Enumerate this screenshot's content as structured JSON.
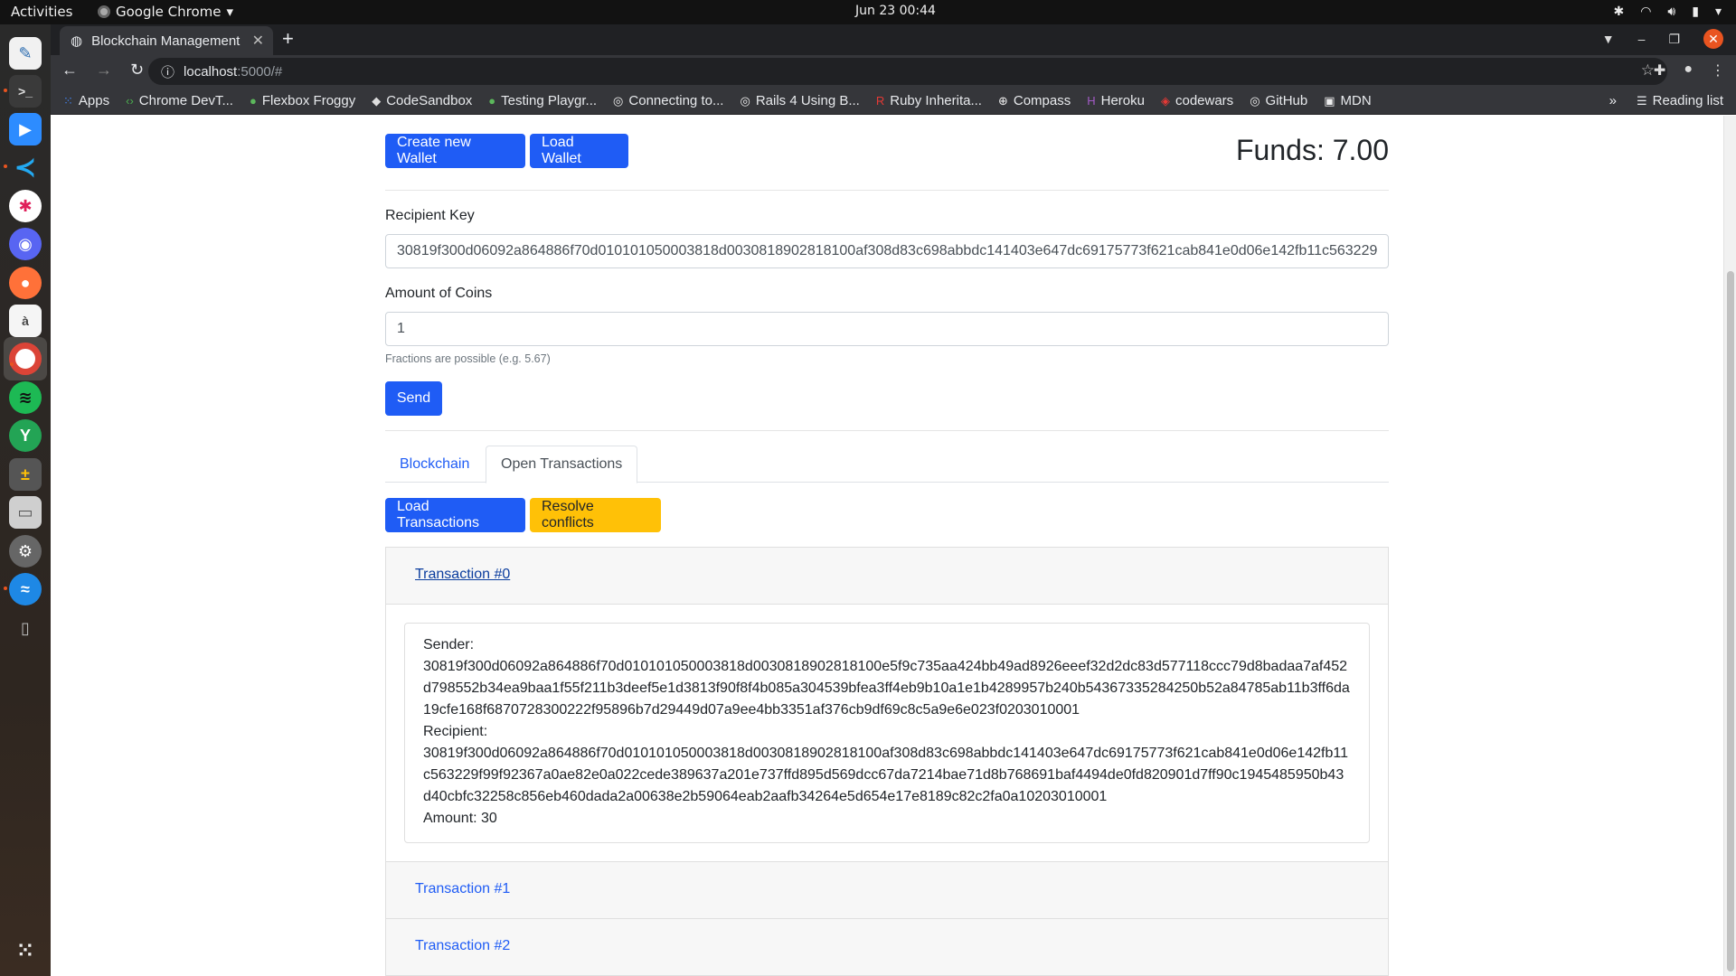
{
  "os": {
    "activities": "Activities",
    "active_app": "Google Chrome",
    "clock": "Jun 23  00:44"
  },
  "browser": {
    "tab_title": "Blockchain Management",
    "url_host": "localhost",
    "url_path": ":5000/#",
    "bookmarks": [
      {
        "label": "Apps",
        "icon": "apps-grid-icon"
      },
      {
        "label": "Chrome DevT...",
        "icon": "devtools-icon"
      },
      {
        "label": "Flexbox Froggy",
        "icon": "frog-icon"
      },
      {
        "label": "CodeSandbox",
        "icon": "cube-icon"
      },
      {
        "label": "Testing Playgr...",
        "icon": "frog-icon"
      },
      {
        "label": "Connecting to...",
        "icon": "github-icon"
      },
      {
        "label": "Rails 4 Using B...",
        "icon": "github-icon"
      },
      {
        "label": "Ruby Inherita...",
        "icon": "r-icon"
      },
      {
        "label": "Compass",
        "icon": "compass-icon"
      },
      {
        "label": "Heroku",
        "icon": "heroku-icon"
      },
      {
        "label": "codewars",
        "icon": "codewars-icon"
      },
      {
        "label": "GitHub",
        "icon": "github-icon"
      },
      {
        "label": "MDN",
        "icon": "mdn-icon"
      }
    ],
    "more_bookmarks": "»",
    "reading_list": "Reading list"
  },
  "page": {
    "create_wallet_label": "Create new Wallet",
    "load_wallet_label": "Load Wallet",
    "funds_text": "Funds: 7.00",
    "recipient_label": "Recipient Key",
    "recipient_value": "30819f300d06092a864886f70d010101050003818d0030818902818100af308d83c698abbdc141403e647dc69175773f621cab841e0d06e142fb11c563229",
    "amount_label": "Amount of Coins",
    "amount_value": "1",
    "amount_helper": "Fractions are possible (e.g. 5.67)",
    "send_label": "Send",
    "tabs": [
      {
        "label": "Blockchain",
        "active": false
      },
      {
        "label": "Open Transactions",
        "active": true
      }
    ],
    "load_transactions_label": "Load Transactions",
    "resolve_conflicts_label": "Resolve conflicts",
    "transactions": [
      {
        "title": "Transaction #0",
        "sender_label": "Sender:",
        "sender": "30819f300d06092a864886f70d010101050003818d0030818902818100e5f9c735aa424bb49ad8926eeef32d2dc83d577118ccc79d8badaa7af452d798552b34ea9baa1f55f211b3deef5e1d3813f90f8f4b085a304539bfea3ff4eb9b10a1e1b4289957b240b54367335284250b52a84785ab11b3ff6da19cfe168f6870728300222f95896b7d29449d07a9ee4bb3351af376cb9df69c8c5a9e6e023f0203010001",
        "recipient_label": "Recipient:",
        "recipient": "30819f300d06092a864886f70d010101050003818d0030818902818100af308d83c698abbdc141403e647dc69175773f621cab841e0d06e142fb11c563229f99f92367a0ae82e0a022cede389637a201e737ffd895d569dcc67da7214bae71d8b768691baf4494de0fd820901d7ff90c1945485950b43d40cbfc32258c856eb460dada2a00638e2b59064eab2aafb34264e5d654e17e8189c82c2fa0a10203010001",
        "amount_text": "Amount: 30"
      },
      {
        "title": "Transaction #1"
      },
      {
        "title": "Transaction #2"
      }
    ]
  }
}
